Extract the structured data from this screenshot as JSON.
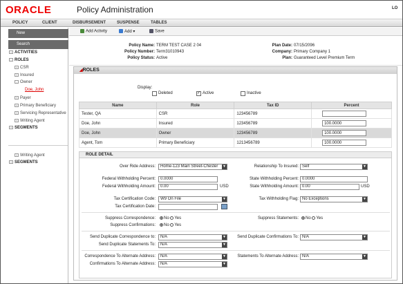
{
  "header": {
    "logo": "ORACLE",
    "title": "Policy Administration",
    "user": "LO"
  },
  "menu": [
    "POLICY",
    "CLIENT",
    "DISBURSEMENT",
    "SUSPENSE",
    "TABLES"
  ],
  "nav": {
    "new": "New",
    "search": "Search",
    "tree": [
      {
        "label": "ACTIVITIES"
      },
      {
        "label": "ROLES"
      },
      {
        "label": "CSR"
      },
      {
        "label": "Insured"
      },
      {
        "label": "Owner"
      },
      {
        "label": "Doe, John"
      },
      {
        "label": "Payer"
      },
      {
        "label": "Primary Beneficiary"
      },
      {
        "label": "Servicing Representative"
      },
      {
        "label": "Writing Agent"
      },
      {
        "label": "SEGMENTS"
      },
      {
        "label": "Writing Agent"
      },
      {
        "label": "SEGMENTS"
      }
    ]
  },
  "toolbar": {
    "add_activity": "Add Activity",
    "add": "Add",
    "save": "Save"
  },
  "summary": {
    "policy_name_label": "Policy Name:",
    "policy_name": "TERM TEST CASE 2 04",
    "policy_number_label": "Policy Number:",
    "policy_number": "Term31010943",
    "policy_status_label": "Policy Status:",
    "policy_status": "Active",
    "plan_date_label": "Plan Date:",
    "plan_date": "07/15/2096",
    "company_label": "Company:",
    "company": "Primary Company 1",
    "plan_label": "Plan:",
    "plan": "Guaranteed Level Premium Term"
  },
  "roles": {
    "title": "ROLES",
    "display_label": "Display:",
    "deleted": "Deleted",
    "active": "Active",
    "inactive": "Inactive",
    "columns": [
      "Name",
      "Role",
      "Tax ID",
      "Percent"
    ],
    "rows": [
      {
        "name": "Tester, QA",
        "role": "CSR",
        "tax_id": "123456789",
        "percent": ""
      },
      {
        "name": "Doe, John",
        "role": "Insured",
        "tax_id": "123456789",
        "percent": "100.0000"
      },
      {
        "name": "Doe, John",
        "role": "Owner",
        "tax_id": "123456789",
        "percent": "100.0000"
      },
      {
        "name": "Agent, Tom",
        "role": "Primary Beneficiary",
        "tax_id": "1213456789",
        "percent": "100.0000"
      }
    ]
  },
  "detail": {
    "title": "ROLE DETAIL",
    "override_label": "Over Ride Address:",
    "override": "Home-123 Main Street-Chester",
    "relationship_label": "Relationship To Insured:",
    "relationship": "Self",
    "fed_pct_label": "Federal Withholding Percent:",
    "fed_pct": "0.0000",
    "fed_amt_label": "Federal Withholding Amount:",
    "fed_amt": "0.00",
    "usd": "USD",
    "state_pct_label": "State Withholding Percent:",
    "state_pct": "0.0000",
    "state_amt_label": "State Withholding Amount:",
    "state_amt": "0.00",
    "tax_code_label": "Tax Certification Code:",
    "tax_code": "W9 On File",
    "tax_date_label": "Tax Certification Date:",
    "tax_date": "",
    "tax_flag_label": "Tax Withholding Flag:",
    "tax_flag": "No Exceptions",
    "supp_corr_label": "Suppress Correspondence:",
    "supp_conf_label": "Suppress Confirmations:",
    "supp_stmt_label": "Suppress Statements:",
    "no": "No",
    "yes": "Yes",
    "dup_corr_label": "Send Duplicate Correspondence to:",
    "dup_corr": "N/A",
    "dup_stmt_label": "Send Duplicate Statements To:",
    "dup_stmt": "N/A",
    "dup_conf_label": "Send Duplicate Confirmations To:",
    "dup_conf": "N/A",
    "alt_corr_label": "Correspondence To Alternate Address:",
    "alt_corr": "N/A",
    "alt_conf_label": "Confirmations To Alternate Address:",
    "alt_conf": "N/A",
    "alt_stmt_label": "Statements To Alternate Address:",
    "alt_stmt": "N/A"
  }
}
